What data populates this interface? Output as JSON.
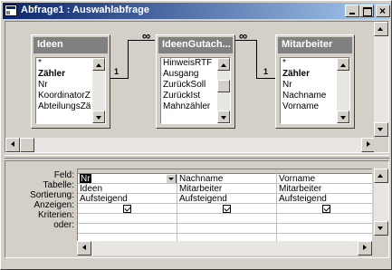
{
  "window": {
    "title": "Abfrage1 : Auswahlabfrage"
  },
  "tables": [
    {
      "name": "Ideen",
      "fields": [
        "*",
        "Zähler",
        "Nr",
        "KoordinatorZä",
        "AbteilungsZäh"
      ]
    },
    {
      "name": "IdeenGutach...",
      "fields": [
        "HinweisRTF",
        "Ausgang",
        "ZurückSoll",
        "ZurückIst",
        "Mahnzähler"
      ]
    },
    {
      "name": "Mitarbeiter",
      "fields": [
        "*",
        "Zähler",
        "Nr",
        "Nachname",
        "Vorname"
      ]
    }
  ],
  "relations": [
    {
      "one": "1",
      "many": "∞"
    },
    {
      "many": "∞",
      "one": "1"
    }
  ],
  "grid": {
    "row_labels": [
      "Feld:",
      "Tabelle:",
      "Sortierung:",
      "Anzeigen:",
      "Kriterien:",
      "oder:"
    ],
    "columns": [
      {
        "field": "Nr",
        "table": "Ideen",
        "sort": "Aufsteigend",
        "show": true
      },
      {
        "field": "Nachname",
        "table": "Mitarbeiter",
        "sort": "Aufsteigend",
        "show": true
      },
      {
        "field": "Vorname",
        "table": "Mitarbeiter",
        "sort": "Aufsteigend",
        "show": true
      }
    ]
  },
  "icons": {
    "app": "query-icon",
    "minimize": "minimize-icon",
    "maximize": "maximize-icon",
    "close": "close-icon"
  }
}
